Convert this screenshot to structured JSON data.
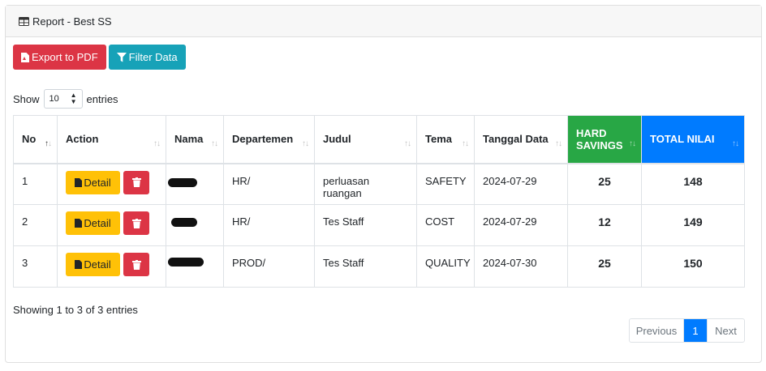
{
  "card": {
    "title": "Report - Best SS",
    "title_icon": "table-icon"
  },
  "toolbar": {
    "export_label": "Export to PDF",
    "export_icon": "pdf-file-icon",
    "filter_label": "Filter Data",
    "filter_icon": "filter-icon"
  },
  "length": {
    "prefix": "Show",
    "value": "10",
    "suffix": "entries"
  },
  "table": {
    "columns": [
      "No",
      "Action",
      "Nama",
      "Departemen",
      "Judul",
      "Tema",
      "Tanggal Data",
      "HARD SAVINGS",
      "TOTAL NILAI"
    ],
    "detail_label": "Detail",
    "rows": [
      {
        "no": "1",
        "nama": "",
        "departemen": "HR/",
        "judul": "perluasan ruangan",
        "tema": "SAFETY",
        "tanggal": "2024-07-29",
        "hard_savings": "25",
        "total_nilai": "148"
      },
      {
        "no": "2",
        "nama": "",
        "departemen": "HR/",
        "judul": "Tes Staff",
        "tema": "COST",
        "tanggal": "2024-07-29",
        "hard_savings": "12",
        "total_nilai": "149"
      },
      {
        "no": "3",
        "nama": "",
        "departemen": "PROD/",
        "judul": "Tes Staff",
        "tema": "QUALITY",
        "tanggal": "2024-07-30",
        "hard_savings": "25",
        "total_nilai": "150"
      }
    ]
  },
  "info": "Showing 1 to 3 of 3 entries",
  "pagination": {
    "previous": "Previous",
    "current": "1",
    "next": "Next"
  },
  "colors": {
    "red": "#dc3545",
    "teal": "#17a2b8",
    "yellow": "#ffc107",
    "green": "#28a745",
    "blue": "#007bff"
  }
}
